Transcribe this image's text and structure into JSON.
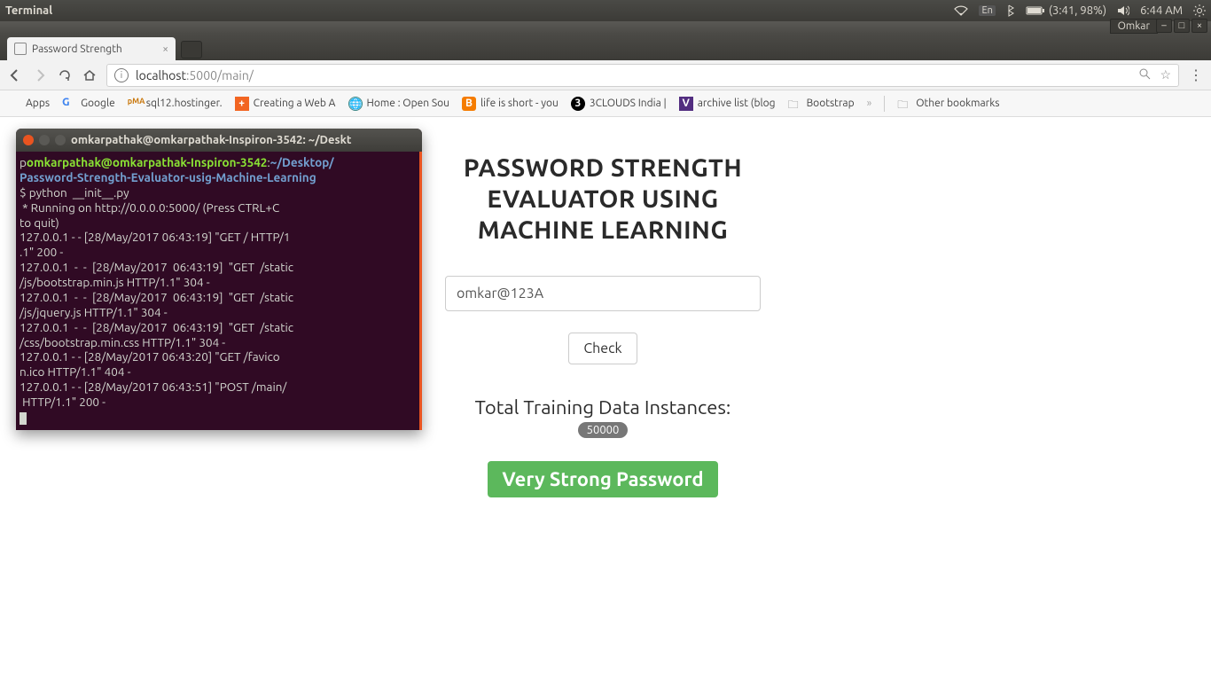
{
  "os": {
    "active_app": "Terminal",
    "user_menu": "Omkar",
    "indicators": {
      "lang": "En",
      "battery": "(3:41, 98%)",
      "clock": "6:44 AM"
    }
  },
  "browser": {
    "tab_title": "Password Strength",
    "url_host": "localhost",
    "url_port_path": ":5000/main/",
    "bookmarks": [
      {
        "label": "Apps",
        "icon": "grid"
      },
      {
        "label": "Google",
        "icon": "g"
      },
      {
        "label": "sql12.hostinger.",
        "icon": "pma"
      },
      {
        "label": "Creating a Web A",
        "icon": "plus"
      },
      {
        "label": "Home : Open Sou",
        "icon": "globe"
      },
      {
        "label": "life is short - you",
        "icon": "blogger"
      },
      {
        "label": "3CLOUDS India |",
        "icon": "three"
      },
      {
        "label": "archive list (blog",
        "icon": "v"
      },
      {
        "label": "Bootstrap",
        "icon": "folder"
      }
    ],
    "overflow": "»",
    "other_bm": "Other bookmarks"
  },
  "app": {
    "title_l1": "PASSWORD STRENGTH",
    "title_l2": "EVALUATOR USING",
    "title_l3": "MACHINE LEARNING",
    "password_value": "omkar@123A",
    "check_label": "Check",
    "tdi_label": "Total Training Data Instances:",
    "tdi_value": "50000",
    "result": "Very Strong Password"
  },
  "terminal": {
    "title": "omkarpathak@omkarpathak-Inspiron-3542: ~/Deskt",
    "user": "omkarpathak@omkarpathak-Inspiron-3542",
    "cwd": "~/Desktop/",
    "cwd2": "Password-Strength-Evaluator-usig-Machine-Learning",
    "lines": [
      "$ python  __init__.py",
      " * Running on http://0.0.0.0:5000/ (Press CTRL+C",
      "to quit)",
      "127.0.0.1 - - [28/May/2017 06:43:19] \"GET / HTTP/1",
      ".1\" 200 -",
      "127.0.0.1  -  -  [28/May/2017  06:43:19]  \"GET  /static",
      "/js/bootstrap.min.js HTTP/1.1\" 304 -",
      "127.0.0.1  -  -  [28/May/2017  06:43:19]  \"GET  /static",
      "/js/jquery.js HTTP/1.1\" 304 -",
      "127.0.0.1  -  -  [28/May/2017  06:43:19]  \"GET  /static",
      "/css/bootstrap.min.css HTTP/1.1\" 304 -",
      "127.0.0.1 - - [28/May/2017 06:43:20] \"GET /favico",
      "n.ico HTTP/1.1\" 404 -",
      "127.0.0.1 - - [28/May/2017 06:43:51] \"POST /main/",
      " HTTP/1.1\" 200 -"
    ]
  }
}
